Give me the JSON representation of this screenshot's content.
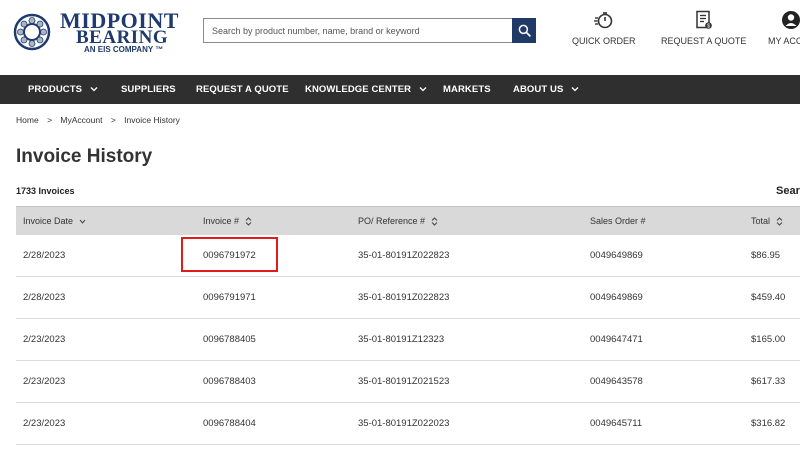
{
  "header": {
    "logo": {
      "line1": "MIDPOINT",
      "line2": "BEARING",
      "line3": "AN EIS COMPANY ™"
    },
    "search_placeholder": "Search by product number, name, brand or keyword",
    "actions": [
      {
        "label": "QUICK ORDER",
        "icon": "quick-order-icon"
      },
      {
        "label": "REQUEST A QUOTE",
        "icon": "quote-document-icon"
      },
      {
        "label": "MY ACCOUNT",
        "icon": "account-icon"
      }
    ]
  },
  "nav": {
    "items": [
      {
        "label": "PRODUCTS",
        "has_dropdown": true
      },
      {
        "label": "SUPPLIERS",
        "has_dropdown": false
      },
      {
        "label": "REQUEST A QUOTE",
        "has_dropdown": false
      },
      {
        "label": "KNOWLEDGE CENTER",
        "has_dropdown": true
      },
      {
        "label": "MARKETS",
        "has_dropdown": false
      },
      {
        "label": "ABOUT US",
        "has_dropdown": true
      }
    ]
  },
  "breadcrumb": {
    "items": [
      "Home",
      "MyAccount",
      "Invoice History"
    ],
    "separator": ">"
  },
  "page": {
    "title": "Invoice History",
    "count_label": "1733 Invoices",
    "search_label": "Search"
  },
  "table": {
    "columns": [
      "Invoice Date",
      "Invoice #",
      "PO/ Reference #",
      "Sales Order #",
      "Total"
    ],
    "rows": [
      {
        "date": "2/28/2023",
        "invoice": "0096791972",
        "po": "35-01-80191Z022823",
        "sales_order": "0049649869",
        "total": "$86.95"
      },
      {
        "date": "2/28/2023",
        "invoice": "0096791971",
        "po": "35-01-80191Z022823",
        "sales_order": "0049649869",
        "total": "$459.40"
      },
      {
        "date": "2/23/2023",
        "invoice": "0096788405",
        "po": "35-01-80191Z12323",
        "sales_order": "0049647471",
        "total": "$165.00"
      },
      {
        "date": "2/23/2023",
        "invoice": "0096788403",
        "po": "35-01-80191Z021523",
        "sales_order": "0049643578",
        "total": "$617.33"
      },
      {
        "date": "2/23/2023",
        "invoice": "0096788404",
        "po": "35-01-80191Z022023",
        "sales_order": "0049645711",
        "total": "$316.82"
      }
    ]
  },
  "colors": {
    "nav_bg": "#2f2f2f",
    "brand_blue": "#1e3a6e",
    "search_button": "#1f3a66",
    "header_row": "#d9d9d9",
    "highlight": "#e21b1b"
  }
}
